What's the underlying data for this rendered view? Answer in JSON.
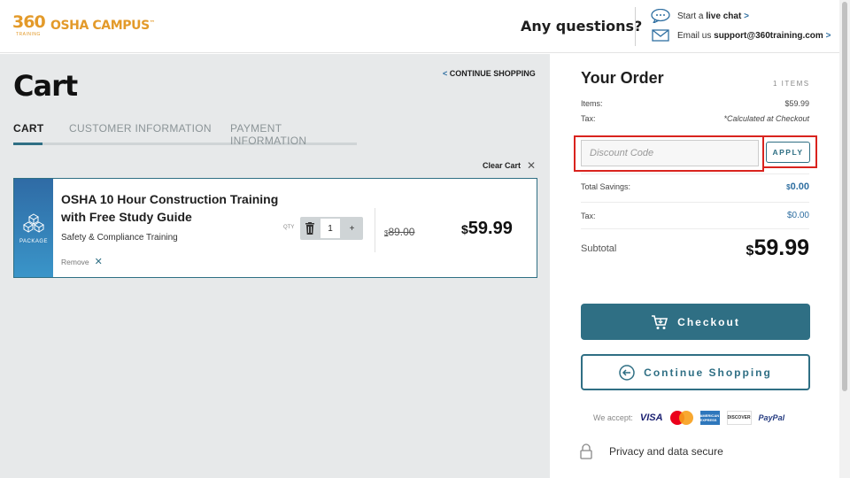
{
  "header": {
    "logo_number": "360",
    "logo_sub": "TRAINING",
    "brand": "OSHA CAMPUS",
    "questions": "Any questions?",
    "chat_prefix": "Start a",
    "chat_link": "live chat",
    "chat_chevron": ">",
    "email_prefix": "Email us",
    "email_link": "support@360training.com",
    "email_chevron": ">"
  },
  "cart": {
    "continue_chevron": "<",
    "continue_label": "CONTINUE SHOPPING",
    "title": "Cart",
    "tabs": [
      {
        "label": "CART"
      },
      {
        "label": "CUSTOMER INFORMATION"
      },
      {
        "label": "PAYMENT INFORMATION"
      }
    ],
    "clear_cart": "Clear Cart",
    "item": {
      "badge": "PACKAGE",
      "title": "OSHA 10 Hour Construction Training with Free Study Guide",
      "subtitle": "Safety & Compliance Training",
      "remove": "Remove",
      "qty_label": "QTY",
      "qty": "1",
      "qty_plus": "+",
      "old_price_symbol": "$",
      "old_price": "89.00",
      "price_symbol": "$",
      "price": "59.99"
    }
  },
  "order": {
    "title": "Your Order",
    "items_count": "1 ITEMS",
    "items_label": "Items:",
    "items_value": "$59.99",
    "tax_label": "Tax:",
    "tax_note": "*Calculated at Checkout",
    "discount_placeholder": "Discount Code",
    "apply": "APPLY",
    "savings_label": "Total Savings:",
    "savings_symbol": "$",
    "savings_value": "0.00",
    "tax2_label": "Tax:",
    "tax2_value": "$0.00",
    "subtotal_label": "Subtotal",
    "subtotal_symbol": "$",
    "subtotal_value": "59.99",
    "checkout": "Checkout",
    "continue": "Continue Shopping",
    "we_accept": "We accept:",
    "cards": {
      "visa": "VISA",
      "amex": "AMERICAN EXPRESS",
      "discover": "DISCOVER",
      "paypal": "PayPal"
    },
    "privacy": "Privacy and data secure"
  },
  "colors": {
    "accent": "#2f6f84",
    "brand_orange": "#e39a2a",
    "highlight": "#d9231e",
    "link": "#2f6fa1"
  }
}
